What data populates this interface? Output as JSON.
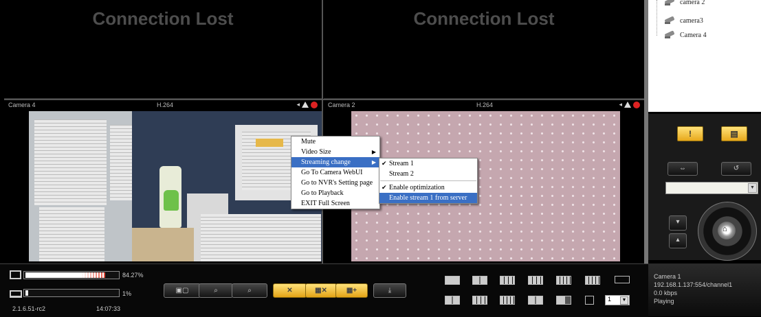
{
  "panes": {
    "top_left_status": "Connection Lost",
    "top_right_status": "Connection Lost",
    "cam_left": {
      "name": "Camera 4",
      "codec": "H.264"
    },
    "cam_right": {
      "name": "Camera 2",
      "codec": "H.264"
    }
  },
  "context_menu": {
    "items": [
      "Mute",
      "Video Size",
      "Streaming change",
      "Go To Camera WebUI",
      "Go to NVR's Setting page",
      "Go to Playback",
      "EXIT Full Screen"
    ],
    "submenu": [
      "Stream 1",
      "Stream 2",
      "Enable optimization",
      "Enable stream 1 from server"
    ],
    "checked": [
      "Stream 1",
      "Enable optimization"
    ],
    "selected_item": "Streaming change",
    "selected_subitem": "Enable stream 1 from server"
  },
  "tree": {
    "items": [
      "camera 2",
      "camera3",
      "Camera 4"
    ]
  },
  "ptz": {
    "alarm_button": "!",
    "combo_value": ""
  },
  "info": {
    "camera": "Camera 1",
    "url": "192.168.1.137:554/channel1",
    "rate": "0.0 kbps",
    "state": "Playing"
  },
  "bottom": {
    "cpu_percent": "84.27%",
    "cpu_level": 0.84,
    "mem_percent": "1%",
    "mem_level": 0.01,
    "version": "2.1.6.51-rc2",
    "time": "14:07:33",
    "sequence_value": "1",
    "delete_label": "✕"
  },
  "colors": {
    "accent_yellow": "#f2c23a",
    "menu_highlight": "#3a6fc4",
    "record_red": "#d22222"
  }
}
